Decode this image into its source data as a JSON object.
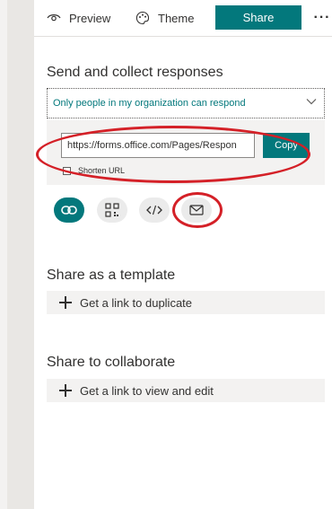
{
  "toolbar": {
    "preview_label": "Preview",
    "theme_label": "Theme",
    "share_label": "Share",
    "more_label": "···"
  },
  "send": {
    "title": "Send and collect responses",
    "audience_selected": "Only people in my organization can respond",
    "link_value": "https://forms.office.com/Pages/Respon",
    "copy_label": "Copy",
    "shorten_label": "Shorten URL"
  },
  "share_types": [
    {
      "icon": "link-icon",
      "selected": true
    },
    {
      "icon": "qr-code-icon",
      "selected": false
    },
    {
      "icon": "embed-code-icon",
      "selected": false
    },
    {
      "icon": "mail-icon",
      "selected": false
    }
  ],
  "template": {
    "title": "Share as a template",
    "action_label": "Get a link to duplicate"
  },
  "collaborate": {
    "title": "Share to collaborate",
    "action_label": "Get a link to view and edit"
  },
  "colors": {
    "accent": "#03787c",
    "annotation": "#d42027"
  }
}
